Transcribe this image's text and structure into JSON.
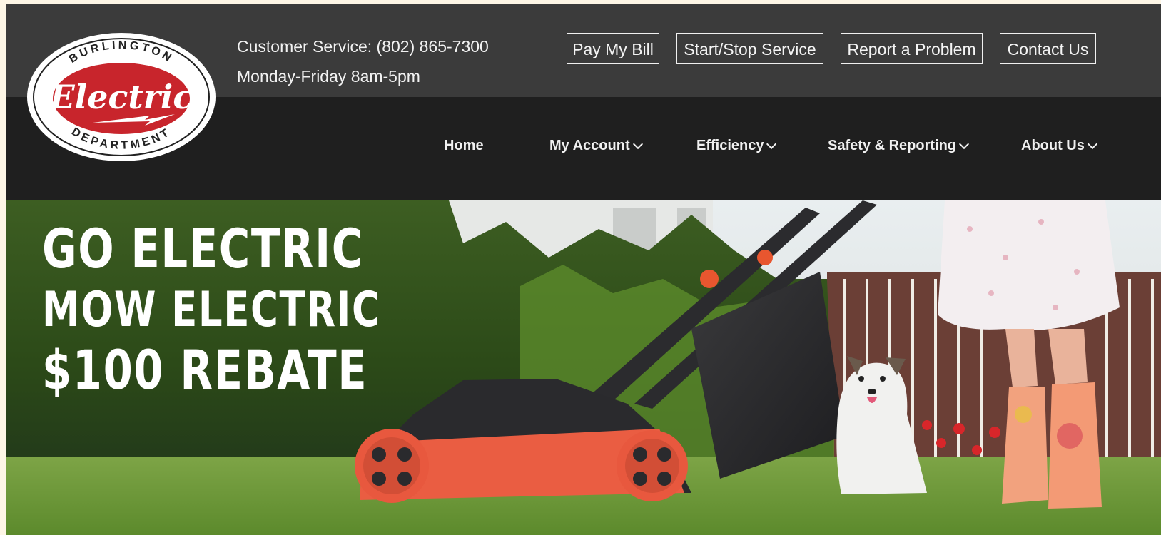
{
  "logo": {
    "top_text": "BURLINGTON",
    "center_text": "Electric",
    "bottom_text": "DEPARTMENT",
    "red": "#c8252c"
  },
  "contact": {
    "phone_line": "Customer Service: (802) 865-7300",
    "hours_line": "Monday-Friday 8am-5pm"
  },
  "utility_nav": [
    {
      "label": "Pay My Bill"
    },
    {
      "label": "Start/Stop Service"
    },
    {
      "label": "Report a Problem"
    },
    {
      "label": "Contact Us"
    }
  ],
  "main_nav": [
    {
      "label": "Home",
      "has_dropdown": false
    },
    {
      "label": "My Account",
      "has_dropdown": true,
      "icon": "chevron-down-icon"
    },
    {
      "label": "Efficiency",
      "has_dropdown": true,
      "icon": "chevron-down-icon"
    },
    {
      "label": "Safety & Reporting",
      "has_dropdown": true,
      "icon": "chevron-down-icon"
    },
    {
      "label": "About Us",
      "has_dropdown": true,
      "icon": "chevron-down-icon"
    }
  ],
  "hero": {
    "line1": "GO ELECTRIC",
    "line2": "MOW ELECTRIC",
    "line3": "$100 REBATE"
  },
  "colors": {
    "topbar": "#3b3b3b",
    "navbar": "#1f1f1f",
    "mower_orange": "#ea5d42",
    "grass": "#6e9a3a"
  }
}
